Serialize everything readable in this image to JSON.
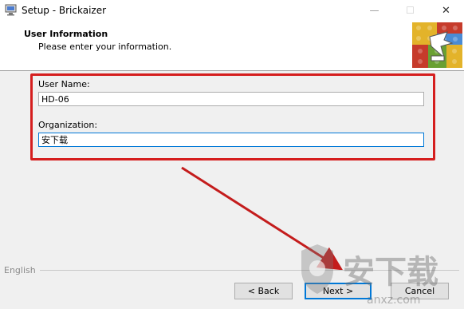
{
  "window": {
    "title": "Setup - Brickaizer",
    "minimize_glyph": "—",
    "maximize_glyph": "☐",
    "close_glyph": "✕"
  },
  "header": {
    "title": "User Information",
    "subtitle": "Please enter your information."
  },
  "form": {
    "username_label": "User Name:",
    "username_value": "HD-06",
    "organization_label": "Organization:",
    "organization_value": "安下载"
  },
  "footer": {
    "brand": "English",
    "back_label": "< Back",
    "next_label": "Next >",
    "cancel_label": "Cancel"
  },
  "watermark": {
    "text": "安下载",
    "subtext": "anxz.com"
  },
  "colors": {
    "highlight": "#d51e1e",
    "focus": "#0078d7"
  }
}
